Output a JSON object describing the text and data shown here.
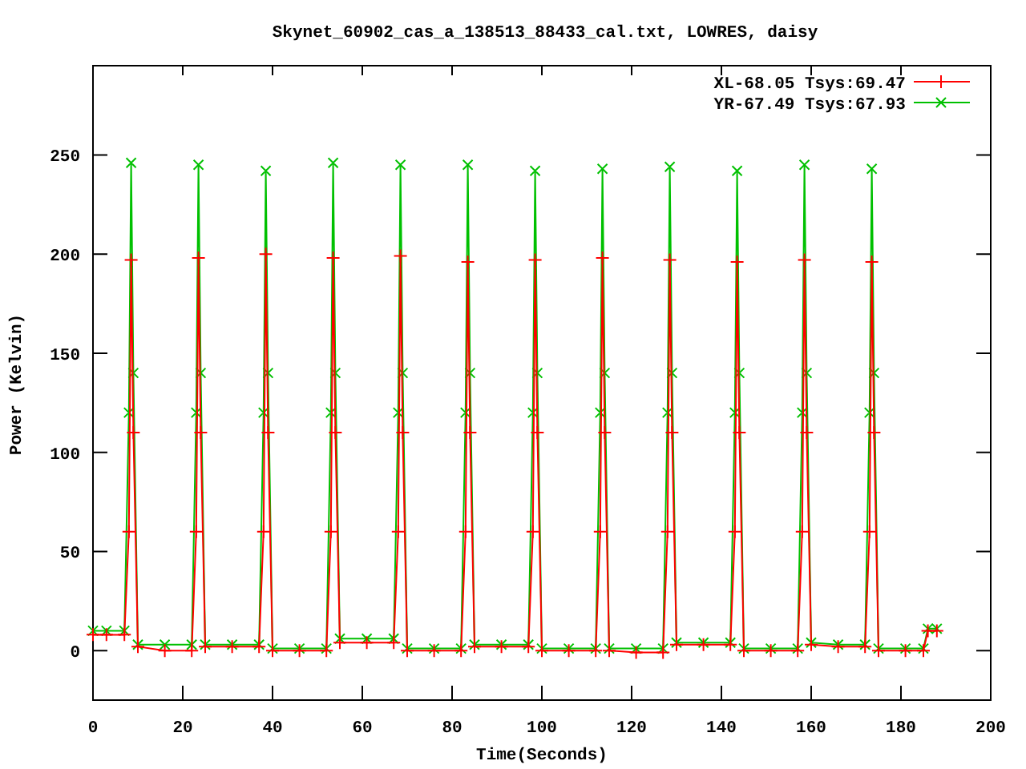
{
  "chart_data": {
    "type": "line",
    "title": "Skynet_60902_cas_a_138513_88433_cal.txt, LOWRES, daisy",
    "xlabel": "Time(Seconds)",
    "ylabel": "Power (Kelvin)",
    "x": [
      0,
      3,
      7,
      8,
      8.5,
      9,
      10,
      16,
      22,
      23,
      23.5,
      24,
      25,
      31,
      37,
      38,
      38.5,
      39,
      40,
      46,
      52,
      53,
      53.5,
      54,
      55,
      61,
      67,
      68,
      68.5,
      69,
      70,
      76,
      82,
      83,
      83.5,
      84,
      85,
      91,
      97,
      98,
      98.5,
      99,
      100,
      106,
      112,
      113,
      113.5,
      114,
      115,
      121,
      127,
      128,
      128.5,
      129,
      130,
      136,
      142,
      143,
      143.5,
      144,
      145,
      151,
      157,
      158,
      158.5,
      159,
      160,
      166,
      172,
      173,
      173.5,
      174,
      175,
      181,
      185,
      186,
      188
    ],
    "series": [
      {
        "name": "XL-68.05 Tsys:69.47",
        "color": "#ff0000",
        "marker": "plus",
        "values": [
          8,
          8,
          8,
          60,
          197,
          110,
          2,
          0,
          0,
          60,
          198,
          110,
          2,
          2,
          2,
          60,
          200,
          110,
          0,
          0,
          0,
          60,
          198,
          110,
          4,
          4,
          4,
          60,
          199,
          110,
          0,
          0,
          0,
          60,
          196,
          110,
          2,
          2,
          2,
          60,
          197,
          110,
          0,
          0,
          0,
          60,
          198,
          110,
          0,
          -1,
          -1,
          60,
          197,
          110,
          3,
          3,
          3,
          60,
          196,
          110,
          0,
          0,
          0,
          60,
          197,
          110,
          3,
          2,
          2,
          60,
          196,
          110,
          0,
          0,
          0,
          10,
          10
        ]
      },
      {
        "name": "YR-67.49 Tsys:67.93",
        "color": "#00c000",
        "marker": "cross",
        "values": [
          10,
          10,
          10,
          120,
          246,
          140,
          3,
          3,
          3,
          120,
          245,
          140,
          3,
          3,
          3,
          120,
          242,
          140,
          1,
          1,
          1,
          120,
          246,
          140,
          6,
          6,
          6,
          120,
          245,
          140,
          1,
          1,
          1,
          120,
          245,
          140,
          3,
          3,
          3,
          120,
          242,
          140,
          1,
          1,
          1,
          120,
          243,
          140,
          1,
          1,
          1,
          120,
          244,
          140,
          4,
          4,
          4,
          120,
          242,
          140,
          1,
          1,
          1,
          120,
          245,
          140,
          4,
          3,
          3,
          120,
          243,
          140,
          1,
          1,
          1,
          11,
          11
        ]
      }
    ],
    "legend": "upper right",
    "xlim": [
      0,
      200
    ],
    "ylim": [
      -25,
      295
    ],
    "xticks": [
      0,
      20,
      40,
      60,
      80,
      100,
      120,
      140,
      160,
      180,
      200
    ],
    "yticks": [
      0,
      50,
      100,
      150,
      200,
      250
    ]
  }
}
